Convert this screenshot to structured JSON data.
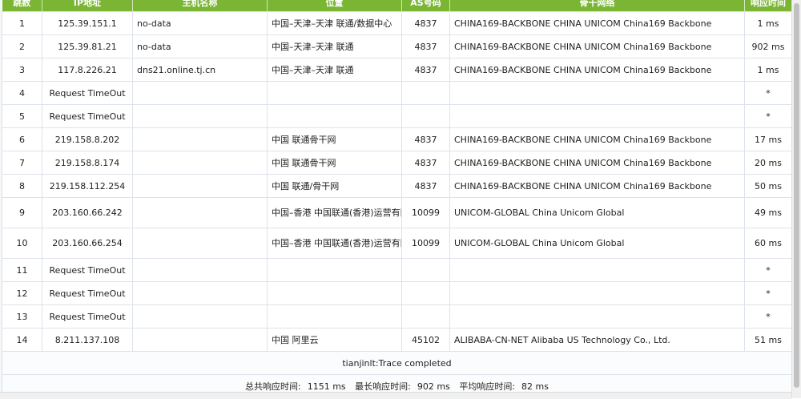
{
  "header": {
    "hop": "跳数",
    "ip": "IP地址",
    "host": "主机名称",
    "location": "位置",
    "as": "AS号码",
    "backbone": "骨干网络",
    "time": "响应时间"
  },
  "rows": [
    {
      "hop": "1",
      "ip": "125.39.151.1",
      "host": "no-data",
      "location": "中国–天津–天津 联通/数据中心",
      "as": "4837",
      "backbone": "CHINA169-BACKBONE CHINA UNICOM China169 Backbone",
      "time": "1 ms"
    },
    {
      "hop": "2",
      "ip": "125.39.81.21",
      "host": "no-data",
      "location": "中国–天津–天津 联通",
      "as": "4837",
      "backbone": "CHINA169-BACKBONE CHINA UNICOM China169 Backbone",
      "time": "902 ms"
    },
    {
      "hop": "3",
      "ip": "117.8.226.21",
      "host": "dns21.online.tj.cn",
      "location": "中国–天津–天津 联通",
      "as": "4837",
      "backbone": "CHINA169-BACKBONE CHINA UNICOM China169 Backbone",
      "time": "1 ms"
    },
    {
      "hop": "4",
      "ip": "Request TimeOut",
      "host": "",
      "location": "",
      "as": "",
      "backbone": "",
      "time": "*"
    },
    {
      "hop": "5",
      "ip": "Request TimeOut",
      "host": "",
      "location": "",
      "as": "",
      "backbone": "",
      "time": "*"
    },
    {
      "hop": "6",
      "ip": "219.158.8.202",
      "host": "",
      "location": "中国 联通骨干网",
      "as": "4837",
      "backbone": "CHINA169-BACKBONE CHINA UNICOM China169 Backbone",
      "time": "17 ms"
    },
    {
      "hop": "7",
      "ip": "219.158.8.174",
      "host": "",
      "location": "中国 联通骨干网",
      "as": "4837",
      "backbone": "CHINA169-BACKBONE CHINA UNICOM China169 Backbone",
      "time": "20 ms"
    },
    {
      "hop": "8",
      "ip": "219.158.112.254",
      "host": "",
      "location": "中国 联通/骨干网",
      "as": "4837",
      "backbone": "CHINA169-BACKBONE CHINA UNICOM China169 Backbone",
      "time": "50 ms"
    },
    {
      "hop": "9",
      "ip": "203.160.66.242",
      "host": "",
      "location": "中国–香港 中国联通(香港)运营有限公司",
      "as": "10099",
      "backbone": "UNICOM-GLOBAL China Unicom Global",
      "time": "49 ms"
    },
    {
      "hop": "10",
      "ip": "203.160.66.254",
      "host": "",
      "location": "中国–香港 中国联通(香港)运营有限公司",
      "as": "10099",
      "backbone": "UNICOM-GLOBAL China Unicom Global",
      "time": "60 ms"
    },
    {
      "hop": "11",
      "ip": "Request TimeOut",
      "host": "",
      "location": "",
      "as": "",
      "backbone": "",
      "time": "*"
    },
    {
      "hop": "12",
      "ip": "Request TimeOut",
      "host": "",
      "location": "",
      "as": "",
      "backbone": "",
      "time": "*"
    },
    {
      "hop": "13",
      "ip": "Request TimeOut",
      "host": "",
      "location": "",
      "as": "",
      "backbone": "",
      "time": "*"
    },
    {
      "hop": "14",
      "ip": "8.211.137.108",
      "host": "",
      "location": "中国 阿里云",
      "as": "45102",
      "backbone": "ALIBABA-CN-NET Alibaba US Technology Co., Ltd.",
      "time": "51 ms"
    }
  ],
  "status": "tianjinlt:Trace completed",
  "summary": {
    "total_label": "总共响应时间:",
    "total_value": "1151 ms",
    "max_label": "最长响应时间:",
    "max_value": "902 ms",
    "avg_label": "平均响应时间:",
    "avg_value": "82 ms"
  },
  "colors": {
    "header_green": "#7ab534",
    "border": "#dde3ea"
  }
}
